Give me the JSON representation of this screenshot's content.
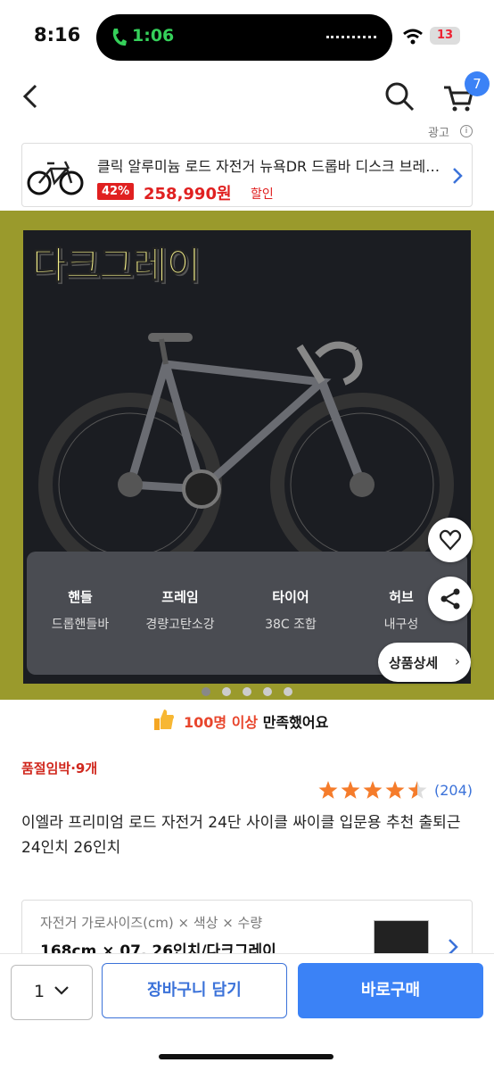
{
  "status_bar": {
    "time": "8:16",
    "call_duration": "1:06",
    "battery": "13"
  },
  "nav": {
    "cart_count": "7"
  },
  "ad": {
    "label": "광고",
    "info": "i",
    "title": "클릭 알루미늄 로드 자전거 뉴욕DR 드롭바 디스크 브레이크",
    "discount": "42%",
    "price": "258,990원",
    "sale_label": "할인"
  },
  "hero": {
    "color_name": "다크그레이",
    "specs": [
      {
        "key": "핸들",
        "value": "드롭핸들바"
      },
      {
        "key": "프레임",
        "value": "경량고탄소강"
      },
      {
        "key": "타이어",
        "value": "38C 조합"
      },
      {
        "key": "허브",
        "value": "내구성"
      }
    ],
    "detail_button": "상품상세",
    "detail_chevron": "›"
  },
  "satisfaction": {
    "highlight": "100명 이상",
    "rest": " 만족했어요"
  },
  "stock_notice": "품절임박·9개",
  "rating": {
    "stars": 4.5,
    "count": "(204)"
  },
  "product_title": "이엘라 프리미엄 로드 자전거 24단 사이클 싸이클 입문용 추천 출퇴근 24인치 26인치",
  "option": {
    "label": "자전거 가로사이즈(cm) × 색상 × 수량",
    "value": "168cm × 07. 26인치/다크그레이"
  },
  "bottom_bar": {
    "quantity": "1",
    "add_to_cart": "장바구니 담기",
    "buy_now": "바로구매"
  },
  "colors": {
    "accent": "#3b82f6",
    "sale": "#e02020",
    "hero_bg": "#9a9a2c"
  }
}
